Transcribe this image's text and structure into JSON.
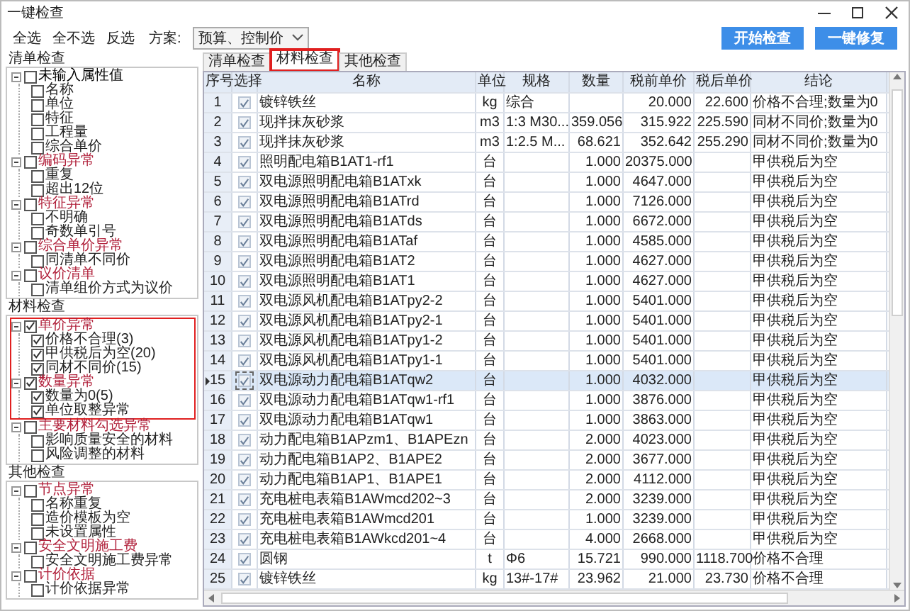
{
  "window": {
    "title": "一键检查"
  },
  "toolbar": {
    "links": [
      "全选",
      "全不选",
      "反选"
    ],
    "scheme_label": "方案:",
    "scheme_value": "预算、控制价",
    "buttons": [
      "开始检查",
      "一键修复"
    ]
  },
  "sections": [
    {
      "title": "清单检查",
      "groups": [
        {
          "label": "未输入属性值",
          "color": "#000000",
          "checked": false,
          "expanded": true,
          "children": [
            {
              "label": "名称",
              "checked": false
            },
            {
              "label": "单位",
              "checked": false
            },
            {
              "label": "特征",
              "checked": false
            },
            {
              "label": "工程量",
              "checked": false
            },
            {
              "label": "综合单价",
              "checked": false
            }
          ]
        },
        {
          "label": "编码异常",
          "color": "#b0203a",
          "checked": false,
          "expanded": true,
          "children": [
            {
              "label": "重复",
              "checked": false
            },
            {
              "label": "超出12位",
              "checked": false
            }
          ]
        },
        {
          "label": "特征异常",
          "color": "#b0203a",
          "checked": false,
          "expanded": true,
          "children": [
            {
              "label": "不明确",
              "checked": false
            },
            {
              "label": "奇数单引号",
              "checked": false
            }
          ]
        },
        {
          "label": "综合单价异常",
          "color": "#b0203a",
          "checked": false,
          "expanded": true,
          "children": [
            {
              "label": "同清单不同价",
              "checked": false
            }
          ]
        },
        {
          "label": "议价清单",
          "color": "#b0203a",
          "checked": false,
          "expanded": true,
          "children": [
            {
              "label": "清单组价方式为议价",
              "checked": false
            }
          ]
        }
      ]
    },
    {
      "title": "材料检查",
      "groups": [
        {
          "label": "单价异常",
          "color": "#b0203a",
          "checked": true,
          "expanded": true,
          "marked": true,
          "children": [
            {
              "label": "价格不合理(3)",
              "checked": true
            },
            {
              "label": "甲供税后为空(20)",
              "checked": true
            },
            {
              "label": "同材不同价(15)",
              "checked": true
            }
          ]
        },
        {
          "label": "数量异常",
          "color": "#b0203a",
          "checked": true,
          "expanded": true,
          "marked": true,
          "children": [
            {
              "label": "数量为0(5)",
              "checked": true
            },
            {
              "label": "单位取整异常",
              "checked": true
            }
          ]
        },
        {
          "label": "主要材料勾选异常",
          "color": "#b0203a",
          "checked": false,
          "expanded": true,
          "children": [
            {
              "label": "影响质量安全的材料",
              "checked": false
            },
            {
              "label": "风险调整的材料",
              "checked": false
            }
          ]
        }
      ]
    },
    {
      "title": "其他检查",
      "groups": [
        {
          "label": "节点异常",
          "color": "#b0203a",
          "checked": false,
          "expanded": true,
          "children": [
            {
              "label": "名称重复",
              "checked": false
            },
            {
              "label": "造价模板为空",
              "checked": false
            },
            {
              "label": "未设置属性",
              "checked": false
            }
          ]
        },
        {
          "label": "安全文明施工费",
          "color": "#b0203a",
          "checked": false,
          "expanded": true,
          "children": [
            {
              "label": "安全文明施工费异常",
              "checked": false
            }
          ]
        },
        {
          "label": "计价依据",
          "color": "#b0203a",
          "checked": false,
          "expanded": true,
          "children": [
            {
              "label": "计价依据异常",
              "checked": false
            }
          ]
        }
      ]
    }
  ],
  "tabs": [
    {
      "label": "清单检查",
      "selected": false,
      "highlighted": false
    },
    {
      "label": "材料检查",
      "selected": true,
      "highlighted": true
    },
    {
      "label": "其他检查",
      "selected": false,
      "highlighted": false
    }
  ],
  "table": {
    "columns": [
      "序号",
      "选择",
      "名称",
      "单位",
      "规格",
      "数量",
      "税前单价",
      "税后单价",
      "结论"
    ],
    "rows": [
      {
        "no": "1",
        "checked": true,
        "name": "镀锌铁丝",
        "unit": "kg",
        "spec": "综合",
        "pre": "20.000",
        "post": "22.600",
        "result": "价格不合理;数量为0",
        "selected": false
      },
      {
        "no": "2",
        "checked": true,
        "name": "现拌抹灰砂浆",
        "unit": "m3",
        "spec": "1:3 M30...",
        "qty": "359.056",
        "pre": "315.922",
        "post": "225.590",
        "result": "同材不同价;数量为0",
        "selected": false
      },
      {
        "no": "3",
        "checked": true,
        "name": "现拌抹灰砂浆",
        "unit": "m3",
        "spec": "1:2.5 M...",
        "qty": "68.621",
        "pre": "352.642",
        "post": "255.290",
        "result": "同材不同价;数量为0",
        "selected": false
      },
      {
        "no": "4",
        "checked": true,
        "name": "照明配电箱B1AT1-rf1",
        "unit": "台",
        "qty": "1.000",
        "pre": "20375.000",
        "result": "甲供税后为空",
        "selected": false
      },
      {
        "no": "5",
        "checked": true,
        "name": "双电源照明配电箱B1ATxk",
        "unit": "台",
        "qty": "1.000",
        "pre": "4647.000",
        "result": "甲供税后为空",
        "selected": false
      },
      {
        "no": "6",
        "checked": true,
        "name": "双电源照明配电箱B1ATrd",
        "unit": "台",
        "qty": "1.000",
        "pre": "7126.000",
        "result": "甲供税后为空",
        "selected": false
      },
      {
        "no": "7",
        "checked": true,
        "name": "双电源照明配电箱B1ATds",
        "unit": "台",
        "qty": "1.000",
        "pre": "6672.000",
        "result": "甲供税后为空",
        "selected": false
      },
      {
        "no": "8",
        "checked": true,
        "name": "双电源照明配电箱B1ATaf",
        "unit": "台",
        "qty": "1.000",
        "pre": "4585.000",
        "result": "甲供税后为空",
        "selected": false
      },
      {
        "no": "9",
        "checked": true,
        "name": "双电源照明配电箱B1AT2",
        "unit": "台",
        "qty": "1.000",
        "pre": "4627.000",
        "result": "甲供税后为空",
        "selected": false
      },
      {
        "no": "10",
        "checked": true,
        "name": "双电源照明配电箱B1AT1",
        "unit": "台",
        "qty": "1.000",
        "pre": "4627.000",
        "result": "甲供税后为空",
        "selected": false
      },
      {
        "no": "11",
        "checked": true,
        "name": "双电源风机配电箱B1ATpy2-2",
        "unit": "台",
        "qty": "1.000",
        "pre": "5401.000",
        "result": "甲供税后为空",
        "selected": false
      },
      {
        "no": "12",
        "checked": true,
        "name": "双电源风机配电箱B1ATpy2-1",
        "unit": "台",
        "qty": "1.000",
        "pre": "5401.000",
        "result": "甲供税后为空",
        "selected": false
      },
      {
        "no": "13",
        "checked": true,
        "name": "双电源风机配电箱B1ATpy1-2",
        "unit": "台",
        "qty": "1.000",
        "pre": "5401.000",
        "result": "甲供税后为空",
        "selected": false
      },
      {
        "no": "14",
        "checked": true,
        "name": "双电源风机配电箱B1ATpy1-1",
        "unit": "台",
        "qty": "1.000",
        "pre": "5401.000",
        "result": "甲供税后为空",
        "selected": false
      },
      {
        "no": "15",
        "checked": true,
        "name": "双电源动力配电箱B1ATqw2",
        "unit": "台",
        "qty": "1.000",
        "pre": "4032.000",
        "result": "甲供税后为空",
        "selected": true
      },
      {
        "no": "16",
        "checked": true,
        "name": "双电源动力配电箱B1ATqw1-rf1",
        "unit": "台",
        "qty": "1.000",
        "pre": "3876.000",
        "result": "甲供税后为空",
        "selected": false
      },
      {
        "no": "17",
        "checked": true,
        "name": "双电源动力配电箱B1ATqw1",
        "unit": "台",
        "qty": "1.000",
        "pre": "3863.000",
        "result": "甲供税后为空",
        "selected": false
      },
      {
        "no": "18",
        "checked": true,
        "name": "动力配电箱B1APzm1、B1APEzn",
        "unit": "台",
        "qty": "2.000",
        "pre": "4023.000",
        "result": "甲供税后为空",
        "selected": false
      },
      {
        "no": "19",
        "checked": true,
        "name": "动力配电箱B1AP2、B1APE2",
        "unit": "台",
        "qty": "2.000",
        "pre": "3677.000",
        "result": "甲供税后为空",
        "selected": false
      },
      {
        "no": "20",
        "checked": true,
        "name": "动力配电箱B1AP1、B1APE1",
        "unit": "台",
        "qty": "2.000",
        "pre": "4112.000",
        "result": "甲供税后为空",
        "selected": false
      },
      {
        "no": "21",
        "checked": true,
        "name": "充电桩电表箱B1AWmcd202~3",
        "unit": "台",
        "qty": "2.000",
        "pre": "3239.000",
        "result": "甲供税后为空",
        "selected": false
      },
      {
        "no": "22",
        "checked": true,
        "name": "充电桩电表箱B1AWmcd201",
        "unit": "台",
        "qty": "1.000",
        "pre": "3239.000",
        "result": "甲供税后为空",
        "selected": false
      },
      {
        "no": "23",
        "checked": true,
        "name": "充电桩电表箱B1AWkcd201~4",
        "unit": "台",
        "qty": "4.000",
        "pre": "2668.000",
        "result": "甲供税后为空",
        "selected": false
      },
      {
        "no": "24",
        "checked": true,
        "name": "圆钢",
        "unit": "t",
        "spec": "Φ6",
        "qty": "15.721",
        "pre": "990.000",
        "post": "1118.700",
        "result": "价格不合理",
        "selected": false
      },
      {
        "no": "25",
        "checked": true,
        "name": "镀锌铁丝",
        "unit": "kg",
        "spec": "13#-17#",
        "qty": "23.962",
        "pre": "21.000",
        "post": "23.730",
        "result": "价格不合理",
        "selected": false
      }
    ]
  }
}
